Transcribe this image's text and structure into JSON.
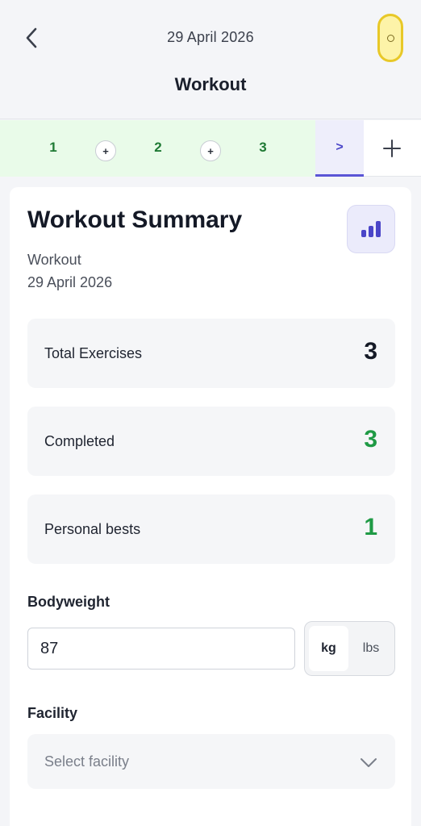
{
  "header": {
    "date": "29 April 2026",
    "title": "Workout",
    "icons": {
      "back": "chevron-left-icon",
      "timer": "timer-pill-icon"
    }
  },
  "tabs": {
    "items": [
      "1",
      "2",
      "3"
    ],
    "add_symbol": "+",
    "next_symbol": ">",
    "new_symbol": "+"
  },
  "summary": {
    "title": "Workout Summary",
    "workout_name": "Workout",
    "date": "29 April 2026",
    "stats_icon": "bar-chart-icon",
    "stats": [
      {
        "label": "Total Exercises",
        "value": "3",
        "color": "#141926"
      },
      {
        "label": "Completed",
        "value": "3",
        "color": "#1f9a45"
      },
      {
        "label": "Personal bests",
        "value": "1",
        "color": "#1f9a45"
      }
    ]
  },
  "bodyweight": {
    "label": "Bodyweight",
    "value": "87",
    "units": [
      "kg",
      "lbs"
    ],
    "selected_unit": "kg"
  },
  "facility": {
    "label": "Facility",
    "placeholder": "Select facility"
  },
  "colors": {
    "accent": "#5a55d6",
    "success": "#1f9a45",
    "timer_bg": "#fdf3a8",
    "timer_border": "#e8c828",
    "tab_bg": "#e9fbe9"
  }
}
